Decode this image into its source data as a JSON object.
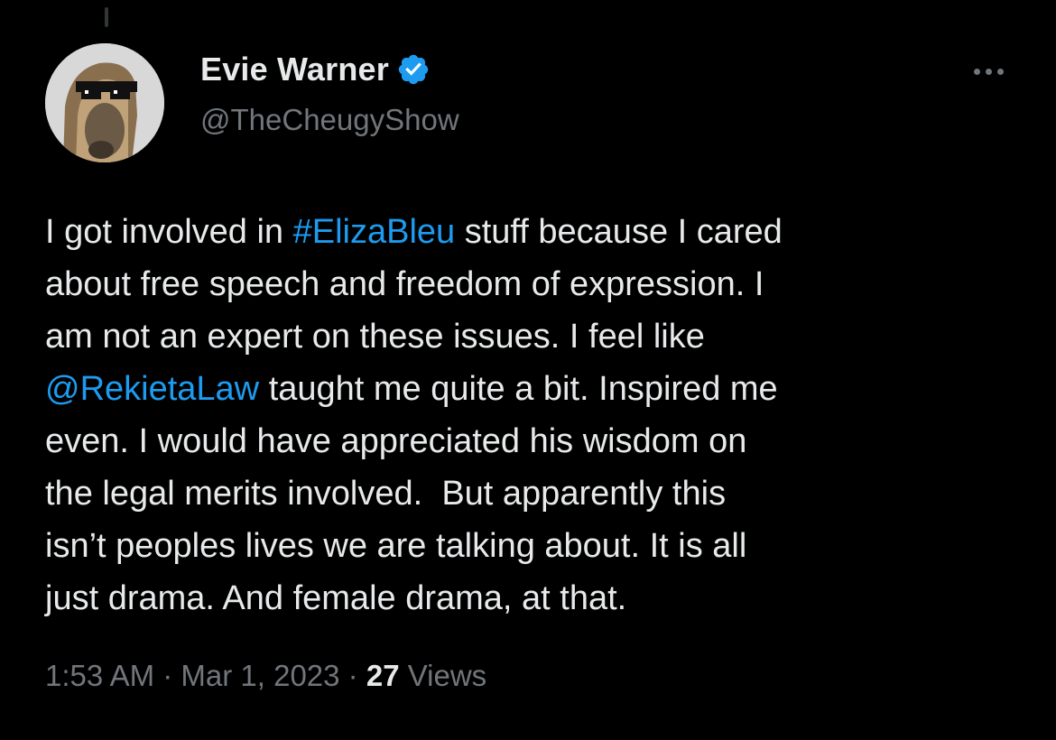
{
  "author": {
    "name": "Evie Warner",
    "handle": "@TheCheugyShow",
    "verified": true,
    "avatar_icon": "avatar-image"
  },
  "menu": {
    "icon": "more-icon"
  },
  "tweet": {
    "segments": [
      {
        "text": "I got involved in ",
        "link": false
      },
      {
        "text": "#ElizaBleu",
        "link": true
      },
      {
        "text": " stuff because I cared\nabout free speech and freedom of expression. I\nam not an expert on these issues. I feel like\n",
        "link": false
      },
      {
        "text": "@RekietaLaw",
        "link": true
      },
      {
        "text": " taught me quite a bit. Inspired me\neven. I would have appreciated his wisdom on\nthe legal merits involved.  But apparently this\nisn’t peoples lives we are talking about. It is all\njust drama. And female drama, at that.",
        "link": false
      }
    ]
  },
  "meta": {
    "time": "1:53 AM",
    "separator": " · ",
    "date": "Mar 1, 2023",
    "views_count": "27",
    "views_label": " Views"
  },
  "colors": {
    "background": "#000000",
    "text": "#e7e9ea",
    "secondary": "#71767b",
    "link": "#1d9bf0",
    "verified": "#1d9bf0"
  }
}
